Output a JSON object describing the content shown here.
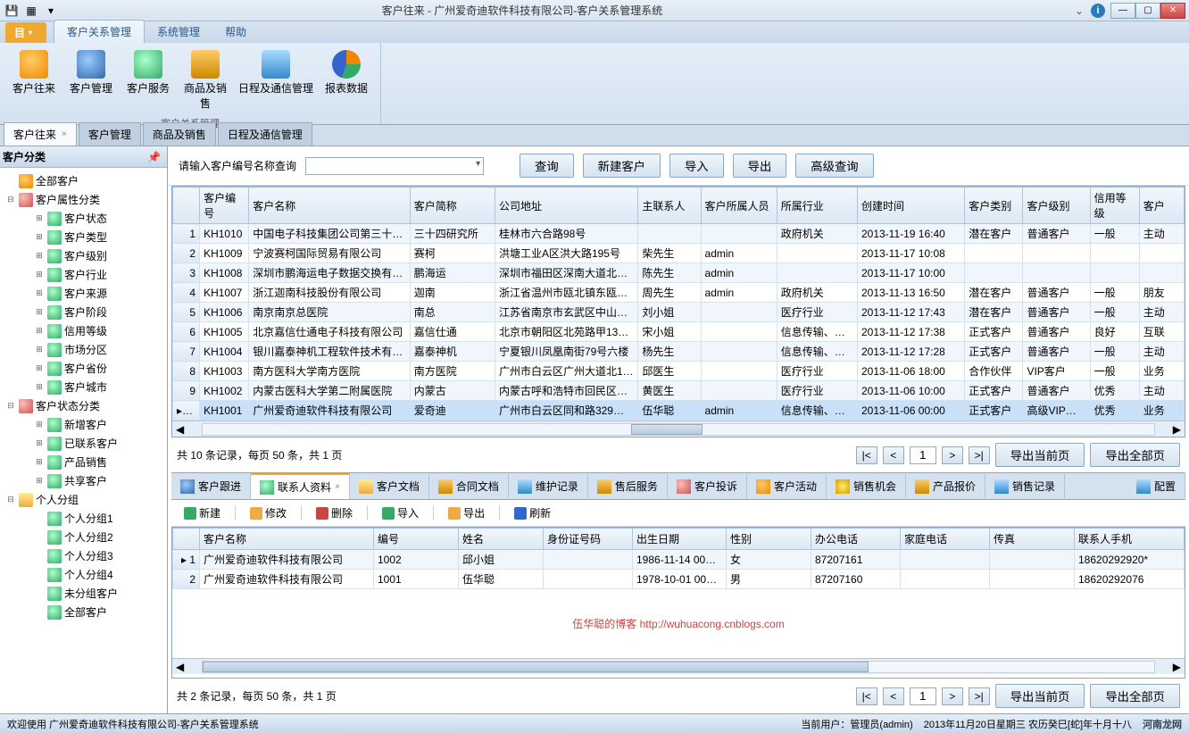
{
  "window": {
    "title": "客户往来 - 广州爱奇迪软件科技有限公司-客户关系管理系统"
  },
  "ribbon": {
    "tabs": {
      "file": "目",
      "crm": "客户关系管理",
      "sys": "系统管理",
      "help": "帮助"
    },
    "group_label": "客户关系管理",
    "buttons": {
      "b1": "客户往来",
      "b2": "客户管理",
      "b3": "客户服务",
      "b4": "商品及销售",
      "b5": "日程及通信管理",
      "b6": "报表数据"
    }
  },
  "doc_tabs": {
    "t1": "客户往来",
    "t2": "客户管理",
    "t3": "商品及销售",
    "t4": "日程及通信管理"
  },
  "sidebar": {
    "header": "客户分类",
    "items": {
      "all": "全部客户",
      "attr": "客户属性分类",
      "a1": "客户状态",
      "a2": "客户类型",
      "a3": "客户级别",
      "a4": "客户行业",
      "a5": "客户来源",
      "a6": "客户阶段",
      "a7": "信用等级",
      "a8": "市场分区",
      "a9": "客户省份",
      "a10": "客户城市",
      "state": "客户状态分类",
      "s1": "新增客户",
      "s2": "已联系客户",
      "s3": "产品销售",
      "s4": "共享客户",
      "personal": "个人分组",
      "p1": "个人分组1",
      "p2": "个人分组2",
      "p3": "个人分组3",
      "p4": "个人分组4",
      "p5": "未分组客户",
      "p6": "全部客户"
    }
  },
  "search": {
    "prompt": "请输入客户编号名称查询",
    "btn_query": "查询",
    "btn_new": "新建客户",
    "btn_import": "导入",
    "btn_export": "导出",
    "btn_adv": "高级查询"
  },
  "grid": {
    "cols": {
      "c0": "",
      "c1": "客户编号",
      "c2": "客户名称",
      "c3": "客户简称",
      "c4": "公司地址",
      "c5": "主联系人",
      "c6": "客户所属人员",
      "c7": "所属行业",
      "c8": "创建时间",
      "c9": "客户类别",
      "c10": "客户级别",
      "c11": "信用等级",
      "c12": "客户"
    },
    "rows": [
      {
        "n": "1",
        "id": "KH1010",
        "name": "中国电子科技集团公司第三十…",
        "short": "三十四研究所",
        "addr": "桂林市六合路98号",
        "contact": "",
        "owner": "",
        "ind": "政府机关",
        "created": "2013-11-19 16:40",
        "cat": "潜在客户",
        "lvl": "普通客户",
        "credit": "一般",
        "src": "主动"
      },
      {
        "n": "2",
        "id": "KH1009",
        "name": "宁波赛柯国际贸易有限公司",
        "short": "赛柯",
        "addr": "洪塘工业A区洪大路195号",
        "contact": "柴先生",
        "owner": "admin",
        "ind": "",
        "created": "2013-11-17 10:08",
        "cat": "",
        "lvl": "",
        "credit": "",
        "src": ""
      },
      {
        "n": "3",
        "id": "KH1008",
        "name": "深圳市鹏海运电子数据交换有…",
        "short": "鹏海运",
        "addr": "深圳市福田区深南大道北…",
        "contact": "陈先生",
        "owner": "admin",
        "ind": "",
        "created": "2013-11-17 10:00",
        "cat": "",
        "lvl": "",
        "credit": "",
        "src": ""
      },
      {
        "n": "4",
        "id": "KH1007",
        "name": "浙江迦南科技股份有限公司",
        "short": "迦南",
        "addr": "浙江省温州市瓯北镇东瓯…",
        "contact": "周先生",
        "owner": "admin",
        "ind": "政府机关",
        "created": "2013-11-13 16:50",
        "cat": "潜在客户",
        "lvl": "普通客户",
        "credit": "一般",
        "src": "朋友"
      },
      {
        "n": "5",
        "id": "KH1006",
        "name": "南京南京总医院",
        "short": "南总",
        "addr": "江苏省南京市玄武区中山…",
        "contact": "刘小姐",
        "owner": "",
        "ind": "医疗行业",
        "created": "2013-11-12 17:43",
        "cat": "潜在客户",
        "lvl": "普通客户",
        "credit": "一般",
        "src": "主动"
      },
      {
        "n": "6",
        "id": "KH1005",
        "name": "北京嘉信仕通电子科技有限公司",
        "short": "嘉信仕通",
        "addr": "北京市朝阳区北苑路甲13…",
        "contact": "宋小姐",
        "owner": "",
        "ind": "信息传输、…",
        "created": "2013-11-12 17:38",
        "cat": "正式客户",
        "lvl": "普通客户",
        "credit": "良好",
        "src": "互联"
      },
      {
        "n": "7",
        "id": "KH1004",
        "name": "银川嘉泰神机工程软件技术有…",
        "short": "嘉泰神机",
        "addr": "宁夏银川凤凰南街79号六楼",
        "contact": "杨先生",
        "owner": "",
        "ind": "信息传输、…",
        "created": "2013-11-12 17:28",
        "cat": "正式客户",
        "lvl": "普通客户",
        "credit": "一般",
        "src": "主动"
      },
      {
        "n": "8",
        "id": "KH1003",
        "name": "南方医科大学南方医院",
        "short": "南方医院",
        "addr": "广州市白云区广州大道北1…",
        "contact": "邱医生",
        "owner": "",
        "ind": "医疗行业",
        "created": "2013-11-06 18:00",
        "cat": "合作伙伴",
        "lvl": "VIP客户",
        "credit": "一般",
        "src": "业务"
      },
      {
        "n": "9",
        "id": "KH1002",
        "name": "内蒙古医科大学第二附属医院",
        "short": "内蒙古",
        "addr": "内蒙古呼和浩特市回民区…",
        "contact": "黄医生",
        "owner": "",
        "ind": "医疗行业",
        "created": "2013-11-06 10:00",
        "cat": "正式客户",
        "lvl": "普通客户",
        "credit": "优秀",
        "src": "主动"
      },
      {
        "n": "10",
        "id": "KH1001",
        "name": "广州爱奇迪软件科技有限公司",
        "short": "爱奇迪",
        "addr": "广州市白云区同和路329号…",
        "contact": "伍华聪",
        "owner": "admin",
        "ind": "信息传输、…",
        "created": "2013-11-06 00:00",
        "cat": "正式客户",
        "lvl": "高级VIP…",
        "credit": "优秀",
        "src": "业务"
      }
    ]
  },
  "pager1": {
    "summary": "共 10 条记录，每页 50 条，共 1 页",
    "page": "1",
    "btn_cur": "导出当前页",
    "btn_all": "导出全部页"
  },
  "subtabs": {
    "t1": "客户跟进",
    "t2": "联系人资料",
    "t3": "客户文档",
    "t4": "合同文档",
    "t5": "维护记录",
    "t6": "售后服务",
    "t7": "客户投诉",
    "t8": "客户活动",
    "t9": "销售机会",
    "t10": "产品报价",
    "t11": "销售记录",
    "cfg": "配置"
  },
  "subtoolbar": {
    "new": "新建",
    "edit": "修改",
    "del": "删除",
    "imp": "导入",
    "exp": "导出",
    "ref": "刷新"
  },
  "subgrid": {
    "cols": {
      "c1": "客户名称",
      "c2": "编号",
      "c3": "姓名",
      "c4": "身份证号码",
      "c5": "出生日期",
      "c6": "性别",
      "c7": "办公电话",
      "c8": "家庭电话",
      "c9": "传真",
      "c10": "联系人手机"
    },
    "rows": [
      {
        "n": "1",
        "cust": "广州爱奇迪软件科技有限公司",
        "id": "1002",
        "name": "邱小姐",
        "idcard": "",
        "dob": "1986-11-14 00…",
        "sex": "女",
        "tel": "87207161",
        "home": "",
        "fax": "",
        "mob": "18620292920*"
      },
      {
        "n": "2",
        "cust": "广州爱奇迪软件科技有限公司",
        "id": "1001",
        "name": "伍华聪",
        "idcard": "",
        "dob": "1978-10-01 00…",
        "sex": "男",
        "tel": "87207160",
        "home": "",
        "fax": "",
        "mob": "18620292076"
      }
    ]
  },
  "watermark": {
    "text": "伍华聪的博客 ",
    "url": "http://wuhuacong.cnblogs.com"
  },
  "pager2": {
    "summary": "共 2 条记录，每页 50 条，共 1 页",
    "page": "1",
    "btn_cur": "导出当前页",
    "btn_all": "导出全部页"
  },
  "status": {
    "welcome": "欢迎使用 广州爱奇迪软件科技有限公司-客户关系管理系统",
    "user": "当前用户：管理员(admin)",
    "date": "2013年11月20日星期三 农历癸巳[蛇]年十月十八",
    "site": "河南龙网"
  }
}
